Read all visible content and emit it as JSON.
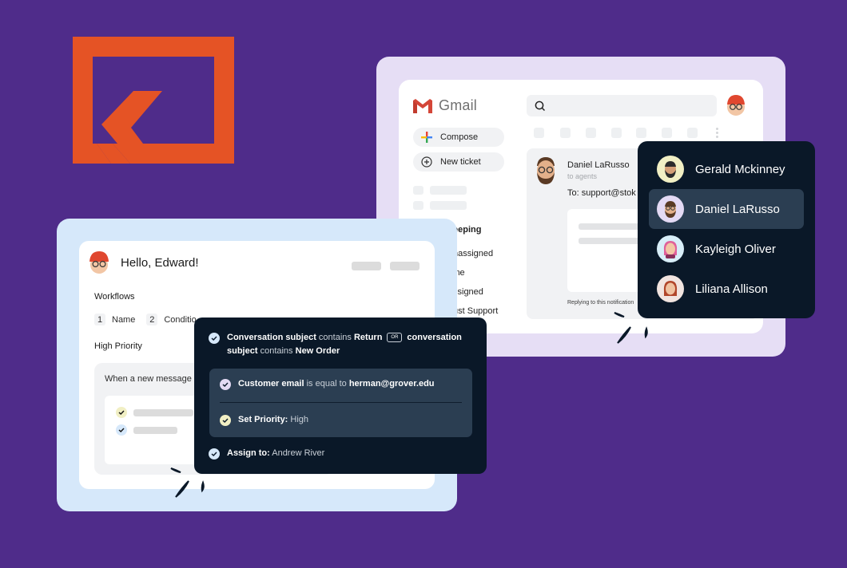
{
  "brand_logo": {
    "name": "company-logo",
    "color": "#e55325"
  },
  "colors": {
    "background": "#4f2c8a",
    "gmail_frame": "#e6def5",
    "workflow_frame": "#d6e8fa",
    "dark_panel": "#0a1828",
    "dark_panel_inner": "#2b3e52"
  },
  "gmail": {
    "brand": "Gmail",
    "compose_label": "Compose",
    "new_ticket_label": "New ticket",
    "sidebar": {
      "section_label": "eeping",
      "items": [
        "nassigned",
        "ine",
        "ssigned",
        "ust Support"
      ]
    },
    "search": {
      "icon": "search-icon",
      "placeholder": ""
    },
    "email": {
      "sender": "Daniel LaRusso",
      "recipient_line": "to agents",
      "to": "To: support@stok",
      "reply_note": "Replying to this notification"
    }
  },
  "agents_dropdown": {
    "items": [
      {
        "name": "Gerald Mckinney",
        "avatar_bg": "#f1efc4",
        "selected": false
      },
      {
        "name": "Daniel LaRusso",
        "avatar_bg": "#e4daf4",
        "selected": true
      },
      {
        "name": "Kayleigh Oliver",
        "avatar_bg": "#d8eef8",
        "selected": false
      },
      {
        "name": "Liliana Allison",
        "avatar_bg": "#f1e4e0",
        "selected": false
      }
    ]
  },
  "workflow": {
    "greeting": "Hello, Edward!",
    "section_title": "Workflows",
    "steps": [
      {
        "num": "1",
        "label": "Name"
      },
      {
        "num": "2",
        "label": "Conditio"
      }
    ],
    "workflow_name": "High Priority",
    "trigger": "When a new message",
    "checks": [
      {
        "color": "#f1efc4"
      },
      {
        "color": "#d6e8fa"
      }
    ]
  },
  "rules_panel": {
    "condition": {
      "field1": "Conversation subject",
      "op1": "contains",
      "value1": "Return",
      "joiner": "OR",
      "field2a": "conversation",
      "field2b": "subject",
      "op2": "contains",
      "value2": "New Order",
      "check_color": "#d6e8fa"
    },
    "customer_email": {
      "field": "Customer email",
      "op": "is equal to",
      "value": "herman@grover.edu",
      "check_color": "#e4daf4"
    },
    "set_priority": {
      "label": "Set Priority:",
      "value": "High",
      "check_color": "#f1efc4"
    },
    "assign": {
      "label": "Assign to:",
      "value": "Andrew River",
      "check_color": "#d6e8fa"
    }
  }
}
